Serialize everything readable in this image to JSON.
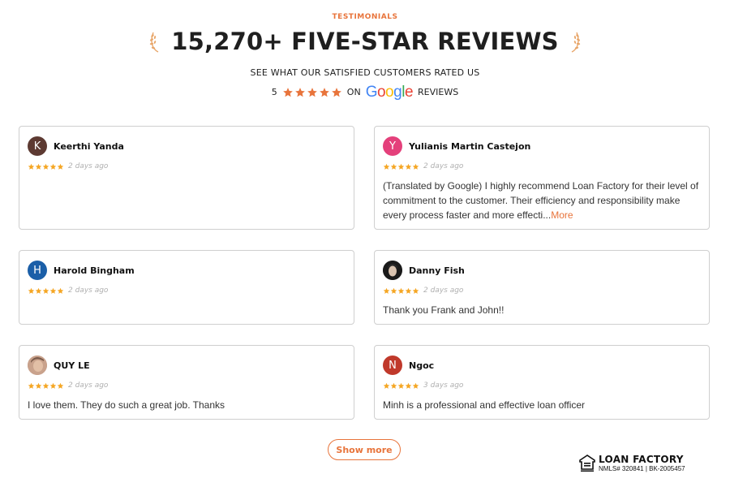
{
  "section": {
    "eyebrow": "TESTIMONIALS",
    "headline": "15,270+ FIVE-STAR REVIEWS",
    "subhead": "SEE WHAT OUR SATISFIED CUSTOMERS RATED US",
    "rating": {
      "score": "5",
      "stars": 5,
      "on_label": "ON",
      "provider_letters": [
        "G",
        "o",
        "o",
        "g",
        "l",
        "e"
      ],
      "suffix": "REVIEWS"
    }
  },
  "colors": {
    "accent": "#e8743b",
    "star": "#f5a623",
    "card_border": "#cfcfcf"
  },
  "reviews": [
    {
      "name": "Keerthi Yanda",
      "initial": "K",
      "avatar_color": "#5d3a32",
      "stars": 5,
      "time": "2 days ago",
      "text": "",
      "more": ""
    },
    {
      "name": "Yulianis Martin Castejon",
      "initial": "Y",
      "avatar_color": "#e4407b",
      "stars": 5,
      "time": "2 days ago",
      "text": "(Translated by Google) I highly recommend Loan Factory for their level of commitment to the customer. Their efficiency and responsibility make every process faster and more effecti...",
      "more": "More"
    },
    {
      "name": "Harold Bingham",
      "initial": "H",
      "avatar_color": "#1b5fa8",
      "stars": 5,
      "time": "2 days ago",
      "text": "",
      "more": ""
    },
    {
      "name": "Danny Fish",
      "initial": "",
      "avatar_color": "#1a1a1a",
      "stars": 5,
      "time": "2 days ago",
      "text": "Thank you Frank and John!!",
      "more": ""
    },
    {
      "name": "QUY LE",
      "initial": "",
      "avatar_color": "#b98b76",
      "stars": 5,
      "time": "2 days ago",
      "text": "I love them. They do such a great job. Thanks",
      "more": ""
    },
    {
      "name": "Ngoc",
      "initial": "N",
      "avatar_color": "#c0392b",
      "stars": 5,
      "time": "3 days ago",
      "text": "Minh is a professional and effective loan officer",
      "more": ""
    }
  ],
  "show_more_label": "Show more",
  "footer_badge": {
    "icon": "equal-housing-lender-icon",
    "logo_text": "LOAN FACTORY",
    "nmls": "NMLS# 320841 | BK-2005457"
  }
}
